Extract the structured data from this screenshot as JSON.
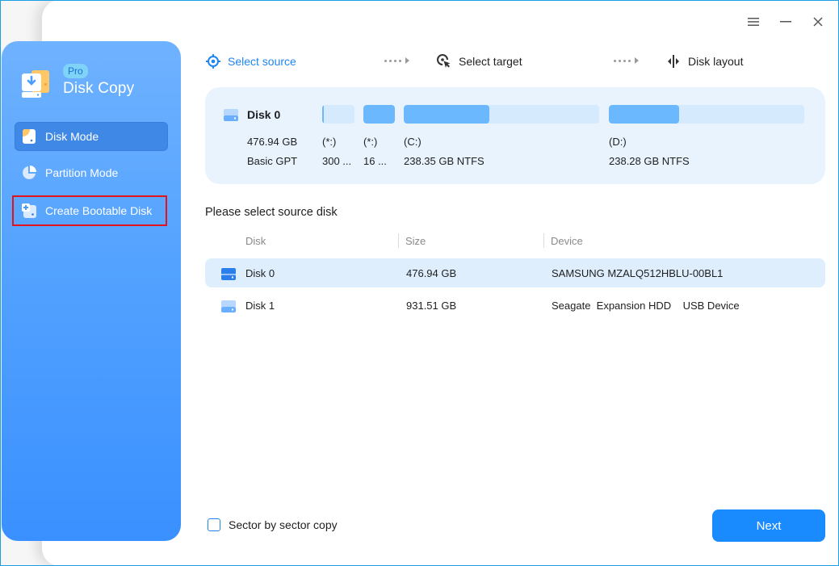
{
  "window": {
    "controls": [
      {
        "name": "menu",
        "icon": "hamburger-menu-icon"
      },
      {
        "name": "minimize",
        "icon": "minimize-icon"
      },
      {
        "name": "close",
        "icon": "close-icon"
      }
    ]
  },
  "sidebar": {
    "badge": "Pro",
    "app_name": "Disk Copy",
    "logo_icon": "disk-copy-logo-icon",
    "items": [
      {
        "label": "Disk Mode",
        "icon": "disk-mode-icon",
        "active": true
      },
      {
        "label": "Partition Mode",
        "icon": "pie-chart-icon",
        "active": false
      },
      {
        "label": "Create Bootable Disk",
        "icon": "bootable-disk-icon",
        "active": false,
        "highlighted": true
      }
    ]
  },
  "steps": [
    {
      "label": "Select source",
      "icon": "crosshair-icon",
      "state": "active"
    },
    {
      "label": "Select target",
      "icon": "target-cursor-icon",
      "state": "pending"
    },
    {
      "label": "Disk layout",
      "icon": "layout-split-icon",
      "state": "pending"
    }
  ],
  "disk_card": {
    "name": "Disk 0",
    "size": "476.94 GB",
    "type": "Basic GPT",
    "partitions": [
      {
        "label": "(*:)",
        "info": "300 ...",
        "used_fraction": 0.06
      },
      {
        "label": "(*:)",
        "info": "16 ...",
        "used_fraction": 1.0
      },
      {
        "label": "(C:)",
        "info": "238.35 GB NTFS",
        "used_fraction": 0.44
      },
      {
        "label": "(D:)",
        "info": "238.28 GB NTFS",
        "used_fraction": 0.36
      }
    ]
  },
  "section": {
    "title": "Please select source disk"
  },
  "table": {
    "columns": [
      "Disk",
      "Size",
      "Device"
    ],
    "rows": [
      {
        "disk": "Disk 0",
        "size": "476.94 GB",
        "device": "SAMSUNG MZALQ512HBLU-00BL1",
        "selected": true
      },
      {
        "disk": "Disk 1",
        "size": "931.51 GB",
        "device": "Seagate  Expansion HDD    USB Device",
        "selected": false
      }
    ]
  },
  "footer": {
    "checkbox_label": "Sector by sector copy",
    "checkbox_checked": false,
    "next_label": "Next"
  },
  "colors": {
    "accent": "#1a8aff",
    "sidebar_top": "#6fb2ff",
    "sidebar_bottom": "#3a90ff",
    "card_bg": "#e8f3fe",
    "partition_fill": "#6bb8ff",
    "partition_track": "#d5eafd",
    "highlight_box": "#e3121b"
  }
}
